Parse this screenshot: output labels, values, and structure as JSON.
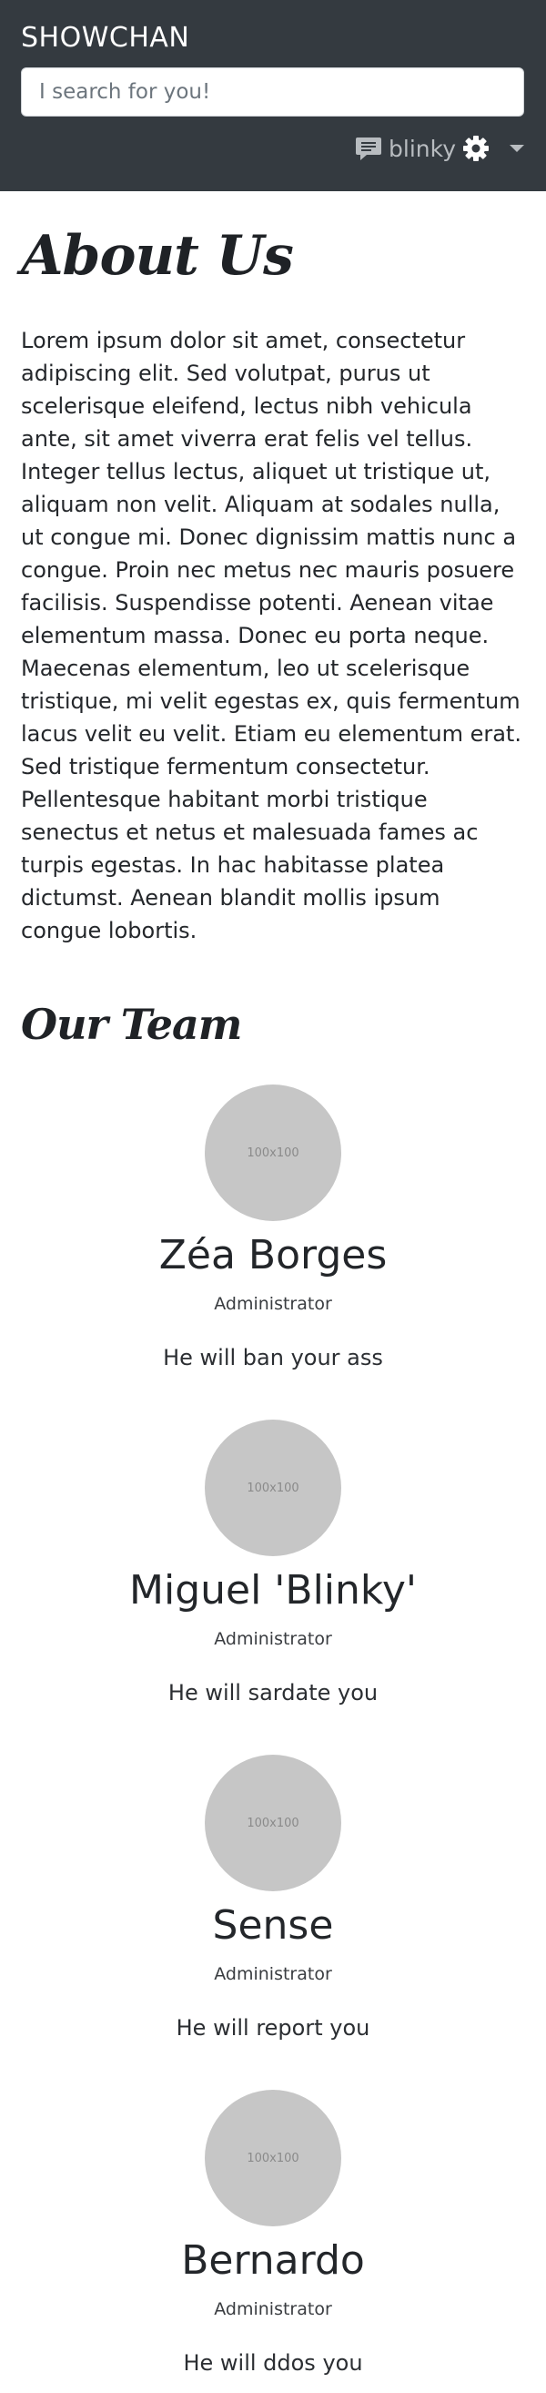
{
  "navbar": {
    "brand": "SHOWCHAN",
    "search_placeholder": "I search for you!",
    "username": "blinky",
    "icons": [
      "chat-icon",
      "gear-icon",
      "caret-down-icon"
    ]
  },
  "about": {
    "title": "About Us",
    "text": "Lorem ipsum dolor sit amet, consectetur adipiscing elit. Sed volutpat, purus ut scelerisque eleifend, lectus nibh vehicula ante, sit amet viverra erat felis vel tellus. Integer tellus lectus, aliquet ut tristique ut, aliquam non velit. Aliquam at sodales nulla, ut congue mi. Donec dignissim mattis nunc a congue. Proin nec metus nec mauris posuere facilisis. Suspendisse potenti. Aenean vitae elementum massa. Donec eu porta neque. Maecenas elementum, leo ut scelerisque tristique, mi velit egestas ex, quis fermentum lacus velit eu velit. Etiam eu elementum erat. Sed tristique fermentum consectetur. Pellentesque habitant morbi tristique senectus et netus et malesuada fames ac turpis egestas. In hac habitasse platea dictumst. Aenean blandit mollis ipsum congue lobortis."
  },
  "team": {
    "title": "Our Team",
    "members": [
      {
        "avatar": "100x100",
        "name": "Zéa Borges",
        "role": "Administrator",
        "quote": "He will ban your ass"
      },
      {
        "avatar": "100x100",
        "name": "Miguel 'Blinky'",
        "role": "Administrator",
        "quote": "He will sardate you"
      },
      {
        "avatar": "100x100",
        "name": "Sense",
        "role": "Administrator",
        "quote": "He will report you"
      },
      {
        "avatar": "100x100",
        "name": "Bernardo",
        "role": "Administrator",
        "quote": "He will ddos you"
      }
    ]
  }
}
